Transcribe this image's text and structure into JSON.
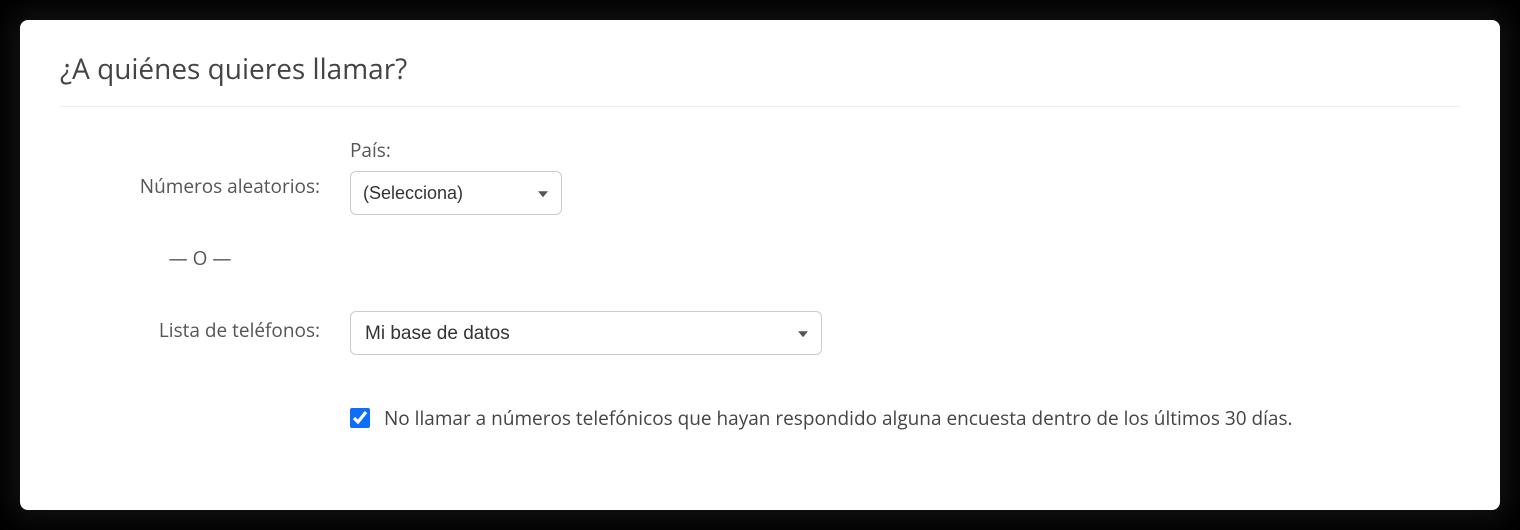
{
  "title": "¿A quiénes quieres llamar?",
  "random_numbers_label": "Números aleatorios:",
  "country_label": "País:",
  "country_placeholder": "(Selecciona)",
  "or_divider": "— O —",
  "phone_list_label": "Lista de teléfonos:",
  "phone_list_value": "Mi base de datos",
  "checkbox_label": "No llamar a números telefónicos que hayan respondido alguna encuesta dentro de los últimos 30 días.",
  "checkbox_checked": true
}
